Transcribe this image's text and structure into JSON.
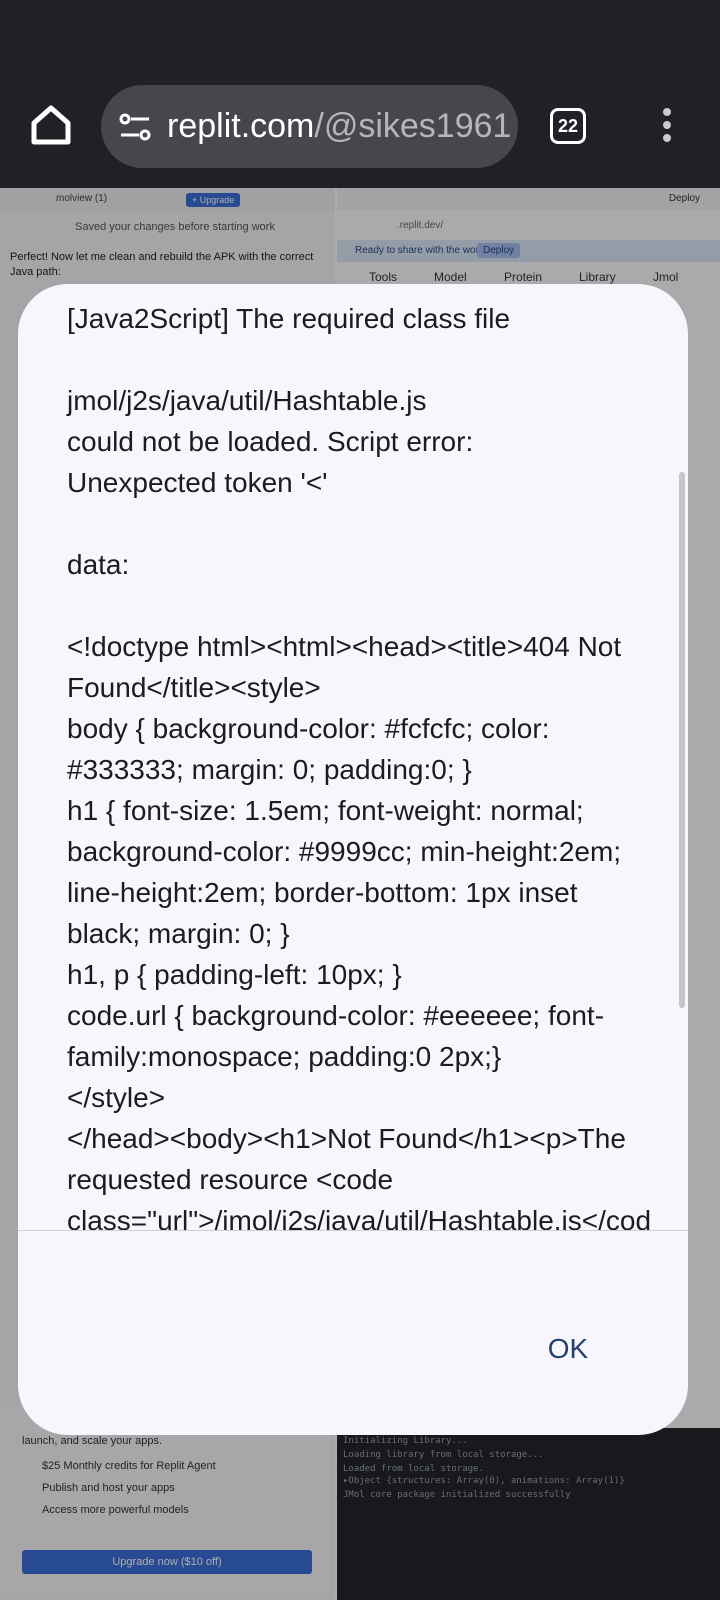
{
  "browser": {
    "url_host": "replit.com",
    "url_path": "/@sikes1961",
    "tab_count": "22"
  },
  "background": {
    "project_name": "molview (1)",
    "upgrade_label": "+ Upgrade",
    "saved_message": "Saved your changes before starting work",
    "agent_message": "Perfect! Now let me clean and rebuild the APK with the correct Java path:",
    "deploy_label": "Deploy",
    "address": ".replit.dev/",
    "ready_message": "Ready to share with the world?",
    "ready_deploy": "Deploy",
    "menu": [
      "Tools",
      "Model",
      "Protein",
      "Library",
      "Jmol"
    ],
    "ad_launch": "launch, and scale your apps.",
    "ad_items": [
      "$25 Monthly credits for Replit Agent",
      "Publish and host your apps",
      "Access more powerful models"
    ],
    "ad_upgrade": "Upgrade now ($10 off)",
    "console_lines": [
      "Initializing Library...",
      "Loading library from local storage...",
      "Loaded from local storage.",
      "▸Object {structures: Array(0), animations: Array(1)}",
      "JMol core package initialized successfully"
    ]
  },
  "dialog": {
    "message": "[Java2Script] The required class file\n\njmol/j2s/java/util/Hashtable.js\ncould not be loaded. Script error:\nUnexpected token '<'\n\ndata:\n\n<!doctype html><html><head><title>404 Not Found</title><style>\nbody { background-color: #fcfcfc; color: #333333; margin: 0; padding:0; }\nh1 { font-size: 1.5em; font-weight: normal; background-color: #9999cc; min-height:2em; line-height:2em; border-bottom: 1px inset black; margin: 0; }\nh1, p { padding-left: 10px; }\ncode.url { background-color: #eeeeee; font-family:monospace; padding:0 2px;}\n</style>\n</head><body><h1>Not Found</h1><p>The requested resource <code class=\"url\">/jmol/j2s/java/util/Hashtable.js</code> was not found on this server.</p></body></html>",
    "ok_label": "OK"
  }
}
